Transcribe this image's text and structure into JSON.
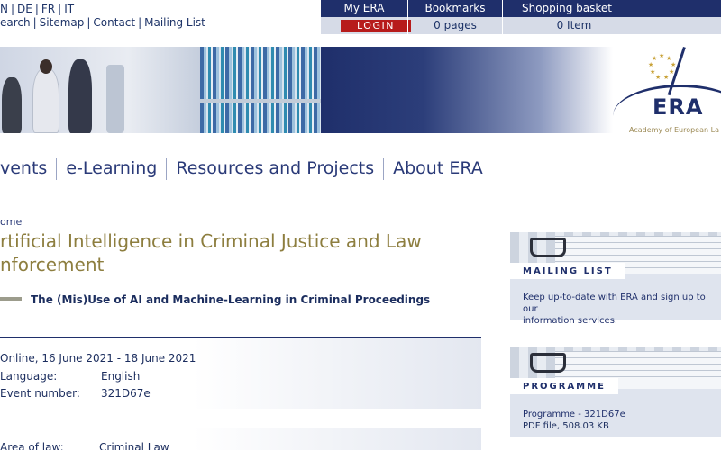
{
  "top_links": {
    "languages": [
      "N",
      "DE",
      "FR",
      "IT"
    ],
    "utility": [
      "earch",
      "Sitemap",
      "Contact",
      "Mailing List"
    ]
  },
  "topbar": {
    "my_era": "My ERA",
    "login": "LOGIN",
    "bookmarks": "Bookmarks",
    "bookmarks_value": "0 pages",
    "basket": "Shopping basket",
    "basket_value": "0 Item",
    "accent_color": "#1f2f6b",
    "login_color": "#b71b1b"
  },
  "logo": {
    "name": "ERA",
    "tagline": "Academy of European La"
  },
  "main_nav": [
    "vents",
    "e-Learning",
    "Resources and Projects",
    "About ERA"
  ],
  "breadcrumb": "ome",
  "event": {
    "title_line1": "rtificial Intelligence in Criminal Justice and Law",
    "title_line2": "nforcement",
    "subtitle": "The (Mis)Use of AI and Machine-Learning in Criminal Proceedings",
    "date": "Online, 16 June 2021 - 18 June 2021",
    "language_label": "Language:",
    "language_value": "English",
    "event_number_label": "Event number:",
    "event_number_value": "321D67e",
    "area_label": "Area of law:",
    "area_value": "Criminal Law"
  },
  "sidebar": {
    "mailing_list": {
      "tab": "MAILING LIST",
      "text_line1": "Keep up-to-date with ERA and sign up to our",
      "text_line2": "information services."
    },
    "programme": {
      "tab": "PROGRAMME",
      "link": "Programme - 321D67e",
      "file_info": "PDF file, 508.03 KB"
    }
  }
}
